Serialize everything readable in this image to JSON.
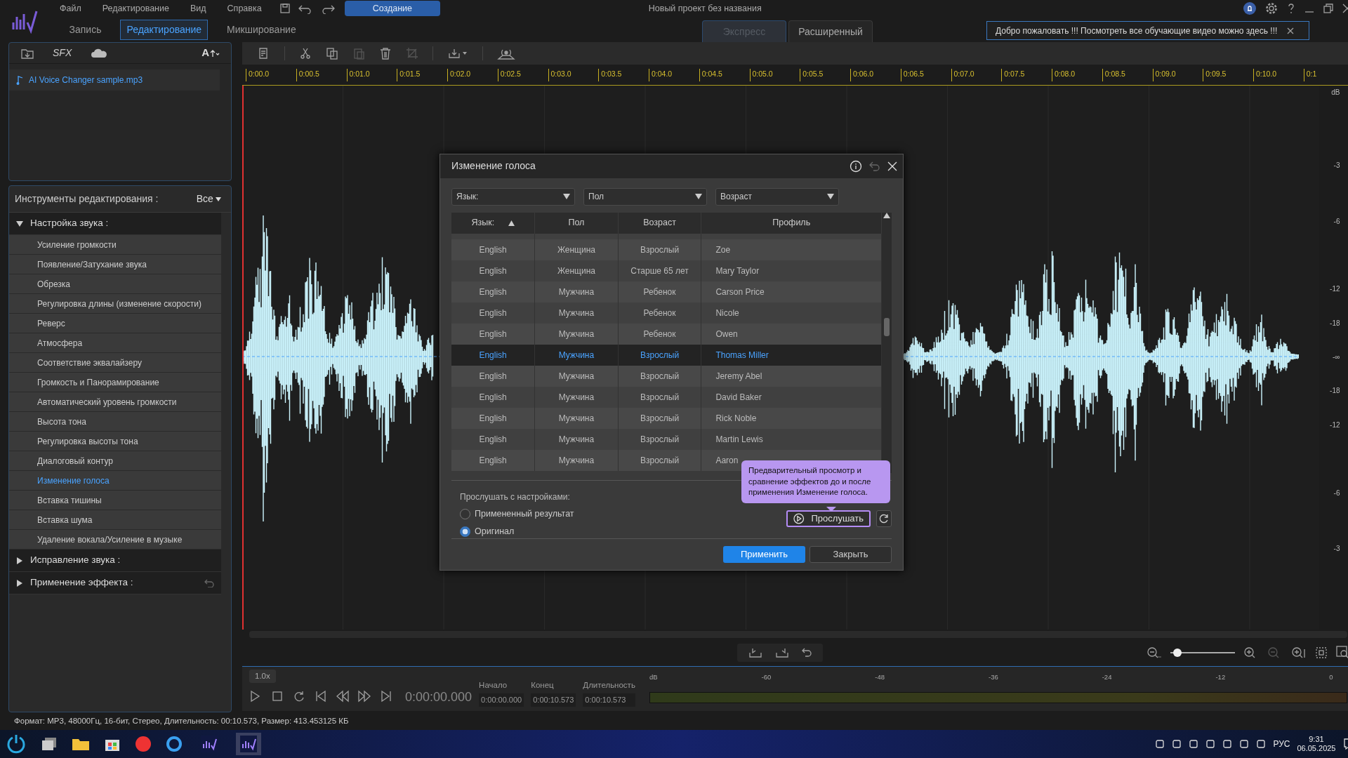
{
  "app": {
    "menu": [
      "Файл",
      "Редактирование",
      "Вид",
      "Справка"
    ],
    "create_button": "Создание",
    "title": "Новый проект без названия"
  },
  "modes": [
    {
      "label": "Запись",
      "selected": false
    },
    {
      "label": "Редактирование",
      "selected": true
    },
    {
      "label": "Микширование",
      "selected": false
    }
  ],
  "view_tabs": [
    {
      "label": "Экспресс",
      "selected": true
    },
    {
      "label": "Расширенный",
      "selected": false
    }
  ],
  "banner": {
    "text": "Добро пожаловать !!! Посмотреть все обучающие видео можно здесь !!!"
  },
  "library": {
    "sfx_button": "SFX",
    "font_button": "A",
    "files": [
      "AI Voice Changer sample.mp3"
    ]
  },
  "tools": {
    "title": "Инструменты редактирования :",
    "filter": "Все",
    "sections": [
      {
        "label": "Настройка звука :",
        "expanded": true,
        "items": [
          {
            "label": "Усиление громкости",
            "selected": false
          },
          {
            "label": "Появление/Затухание звука",
            "selected": false
          },
          {
            "label": "Обрезка",
            "selected": false
          },
          {
            "label": "Регулировка длины (изменение скорости)",
            "selected": false
          },
          {
            "label": "Реверс",
            "selected": false
          },
          {
            "label": "Атмосфера",
            "selected": false
          },
          {
            "label": "Соответствие эквалайзеру",
            "selected": false
          },
          {
            "label": "Громкость и Панорамирование",
            "selected": false
          },
          {
            "label": "Автоматический уровень громкости",
            "selected": false
          },
          {
            "label": "Высота тона",
            "selected": false
          },
          {
            "label": "Регулировка высоты тона",
            "selected": false
          },
          {
            "label": "Диалоговый контур",
            "selected": false
          },
          {
            "label": "Изменение голоса",
            "selected": true
          },
          {
            "label": "Вставка тишины",
            "selected": false
          },
          {
            "label": "Вставка шума",
            "selected": false
          },
          {
            "label": "Удаление вокала/Усиление в музыке",
            "selected": false
          }
        ]
      },
      {
        "label": "Исправление звука :",
        "expanded": false
      },
      {
        "label": "Применение эффекта :",
        "expanded": false
      }
    ]
  },
  "ruler": [
    "0:00.0",
    "0:00.5",
    "0:01.0",
    "0:01.5",
    "0:02.0",
    "0:02.5",
    "0:03.0",
    "0:03.5",
    "0:04.0",
    "0:04.5",
    "0:05.0",
    "0:05.5",
    "0:06.0",
    "0:06.5",
    "0:07.0",
    "0:07.5",
    "0:08.0",
    "0:08.5",
    "0:09.0",
    "0:09.5",
    "0:10.0",
    "0:1"
  ],
  "db_scale": [
    "dB",
    "-3",
    "-6",
    "-12",
    "-18",
    "-∞",
    "-18",
    "-12",
    "-6",
    "-3"
  ],
  "zoom_slider": {
    "level": 0.05
  },
  "transport": {
    "speed": "1.0x",
    "time": "0:00:00.000",
    "fields": [
      {
        "label": "Начало",
        "value": "0:00:00.000"
      },
      {
        "label": "Конец",
        "value": "0:00:10.573"
      },
      {
        "label": "Длительность",
        "value": "0:00:10.573"
      }
    ]
  },
  "meter": {
    "labels": [
      "dB",
      "-60",
      "-48",
      "-36",
      "-24",
      "-12",
      "0"
    ]
  },
  "dialog": {
    "title": "Изменение голоса",
    "filters": [
      "Язык:",
      "Пол",
      "Возраст"
    ],
    "columns": [
      {
        "label": "Язык:",
        "sorted": true
      },
      {
        "label": "Пол",
        "sorted": false
      },
      {
        "label": "Возраст",
        "sorted": false
      },
      {
        "label": "Профиль",
        "sorted": false
      }
    ],
    "rows": [
      {
        "language": "English",
        "gender": "Женщина",
        "age": "Взрослый",
        "profile": "Zoe",
        "selected": false
      },
      {
        "language": "English",
        "gender": "Женщина",
        "age": "Старше 65 лет",
        "profile": "Mary Taylor",
        "selected": false
      },
      {
        "language": "English",
        "gender": "Мужчина",
        "age": "Ребенок",
        "profile": "Carson Price",
        "selected": false
      },
      {
        "language": "English",
        "gender": "Мужчина",
        "age": "Ребенок",
        "profile": "Nicole",
        "selected": false
      },
      {
        "language": "English",
        "gender": "Мужчина",
        "age": "Ребенок",
        "profile": "Owen",
        "selected": false
      },
      {
        "language": "English",
        "gender": "Мужчина",
        "age": "Взрослый",
        "profile": "Thomas Miller",
        "selected": true
      },
      {
        "language": "English",
        "gender": "Мужчина",
        "age": "Взрослый",
        "profile": "Jeremy Abel",
        "selected": false
      },
      {
        "language": "English",
        "gender": "Мужчина",
        "age": "Взрослый",
        "profile": "David Baker",
        "selected": false
      },
      {
        "language": "English",
        "gender": "Мужчина",
        "age": "Взрослый",
        "profile": "Rick Noble",
        "selected": false
      },
      {
        "language": "English",
        "gender": "Мужчина",
        "age": "Взрослый",
        "profile": "Martin Lewis",
        "selected": false
      },
      {
        "language": "English",
        "gender": "Мужчина",
        "age": "Взрослый",
        "profile": "Aaron",
        "selected": false
      }
    ],
    "preview_label": "Прослушать с настройками:",
    "preview_options": [
      {
        "label": "Примененный результат",
        "selected": false
      },
      {
        "label": "Оригинал",
        "selected": true
      }
    ],
    "tooltip": "Предварительный просмотр и сравнение эффектов до и после применения Изменение голоса.",
    "preview_button": "Прослушать",
    "apply_button": "Применить",
    "close_button": "Закрыть"
  },
  "status_bar": "Формат: MP3, 48000Гц, 16-бит, Стерео, Длительность: 00:10.573, Размер: 413.453125 КБ",
  "taskbar": {
    "language": "РУС",
    "time": "9:31",
    "date": "06.05.2025"
  }
}
